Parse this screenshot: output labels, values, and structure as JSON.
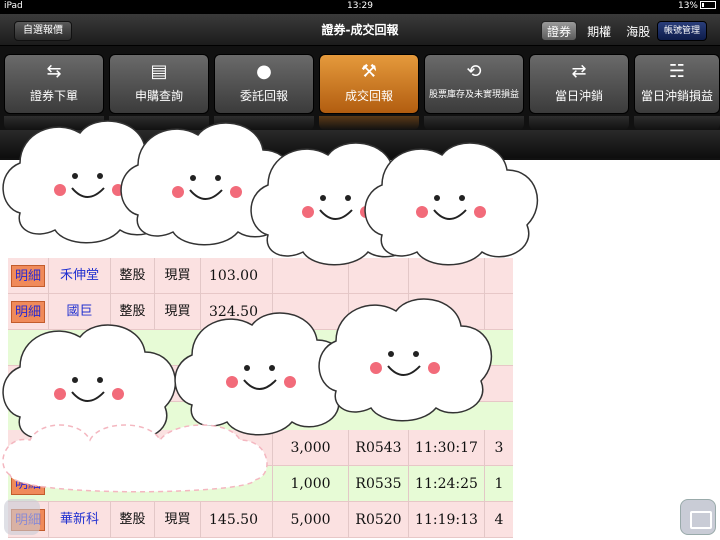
{
  "status": {
    "carrier": "iPad",
    "time": "13:29",
    "battery": "13%"
  },
  "nav": {
    "back_label": "自選報價",
    "title": "證券-成交回報",
    "segments": [
      "證券",
      "期權",
      "海股"
    ],
    "active_segment": "證券",
    "account_label": "帳號管理"
  },
  "toolbar": {
    "items": [
      {
        "label": "證券下單",
        "icon": "exchange-icon"
      },
      {
        "label": "申購查詢",
        "icon": "document-money-icon"
      },
      {
        "label": "委託回報",
        "icon": "user-icon"
      },
      {
        "label": "成交回報",
        "icon": "gavel-icon"
      },
      {
        "label": "股票庫存及未實現損益",
        "icon": "chart-search-icon"
      },
      {
        "label": "當日沖銷",
        "icon": "swap-arrows-icon"
      },
      {
        "label": "當日沖銷損益",
        "icon": "document-search-icon"
      }
    ],
    "active": "成交回報"
  },
  "table": {
    "detail_label": "明細",
    "rows": [
      {
        "name": "禾伸堂",
        "type": "整股",
        "mode": "現買",
        "price": "103.00",
        "qty": "",
        "order": "",
        "time": "",
        "count": "",
        "style": "pink"
      },
      {
        "name": "國巨",
        "type": "整股",
        "mode": "現買",
        "price": "324.50",
        "qty": "",
        "order": "",
        "time": "",
        "count": "",
        "style": "pink"
      },
      {
        "name": "",
        "type": "",
        "mode": "",
        "price": "",
        "qty": "",
        "order": "",
        "time": "",
        "count": "",
        "style": "green"
      },
      {
        "name": "",
        "type": "",
        "mode": "",
        "price": "",
        "qty": "",
        "order": "",
        "time": "",
        "count": "",
        "style": "pink"
      },
      {
        "name": "",
        "type": "",
        "mode": "",
        "price": "",
        "qty": "",
        "order": "",
        "time": "",
        "count": "",
        "style": "green"
      },
      {
        "name": "",
        "type": "",
        "mode": "",
        "price": "",
        "qty": "3,000",
        "order": "R0543",
        "time": "11:30:17",
        "count": "3",
        "style": "pink"
      },
      {
        "name": "",
        "type": "",
        "mode": "",
        "price": "",
        "qty": "1,000",
        "order": "R0535",
        "time": "11:24:25",
        "count": "1",
        "style": "green"
      },
      {
        "name": "華新科",
        "type": "整股",
        "mode": "現買",
        "price": "145.50",
        "qty": "5,000",
        "order": "R0520",
        "time": "11:19:13",
        "count": "4",
        "style": "pink"
      }
    ]
  }
}
